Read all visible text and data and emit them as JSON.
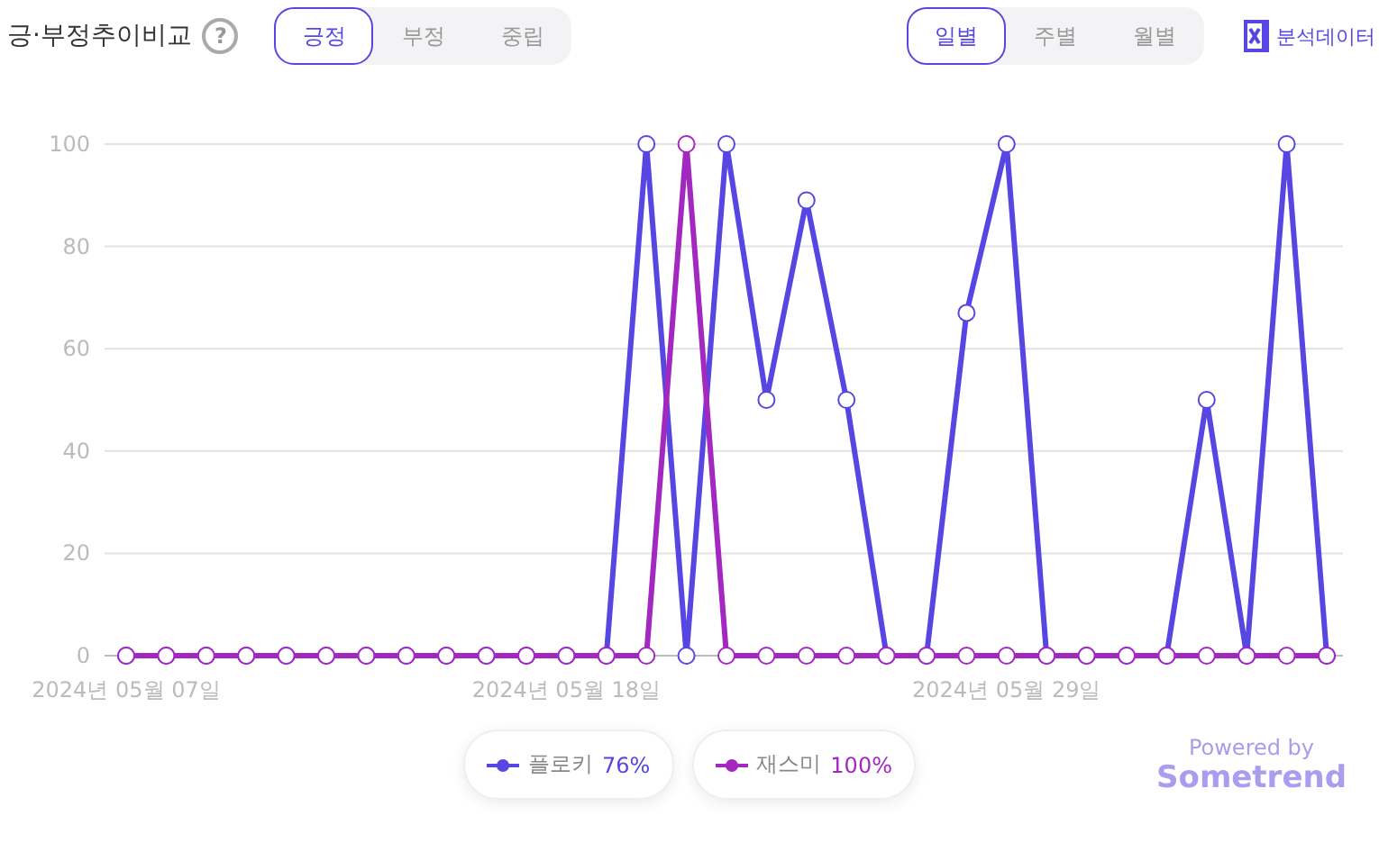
{
  "title": "긍·부정추이비교",
  "help": "?",
  "sentiment_tabs": [
    {
      "label": "긍정",
      "selected": true
    },
    {
      "label": "부정",
      "selected": false
    },
    {
      "label": "중립",
      "selected": false
    }
  ],
  "period_tabs": [
    {
      "label": "일별",
      "selected": true
    },
    {
      "label": "주별",
      "selected": false
    },
    {
      "label": "월별",
      "selected": false
    }
  ],
  "export_label": "분석데이터",
  "chart_data": {
    "type": "line",
    "categories": [
      "2024년 05월 07일",
      null,
      null,
      null,
      null,
      null,
      null,
      null,
      null,
      null,
      null,
      "2024년 05월 18일",
      null,
      null,
      null,
      null,
      null,
      null,
      null,
      null,
      null,
      null,
      "2024년 05월 29일",
      null,
      null,
      null,
      null,
      null,
      null,
      null,
      null
    ],
    "grid": true,
    "ylim": [
      0,
      100
    ],
    "yticks": [
      0,
      20,
      40,
      60,
      80,
      100
    ],
    "series": [
      {
        "name": "플로키",
        "color": "#5846e2",
        "marker": "circle",
        "values": [
          0,
          0,
          0,
          0,
          0,
          0,
          0,
          0,
          0,
          0,
          0,
          0,
          0,
          100,
          0,
          100,
          50,
          89,
          50,
          0,
          0,
          67,
          100,
          0,
          0,
          0,
          0,
          50,
          0,
          100,
          0
        ]
      },
      {
        "name": "재스미",
        "color": "#a228c0",
        "marker": "circle",
        "values": [
          0,
          0,
          0,
          0,
          0,
          0,
          0,
          0,
          0,
          0,
          0,
          0,
          0,
          0,
          100,
          0,
          0,
          0,
          0,
          0,
          0,
          0,
          0,
          0,
          0,
          0,
          0,
          0,
          0,
          0,
          0
        ]
      }
    ]
  },
  "legend_shares": [
    "76%",
    "100%"
  ],
  "powered_by": "Powered by",
  "brand": "Sometrend"
}
